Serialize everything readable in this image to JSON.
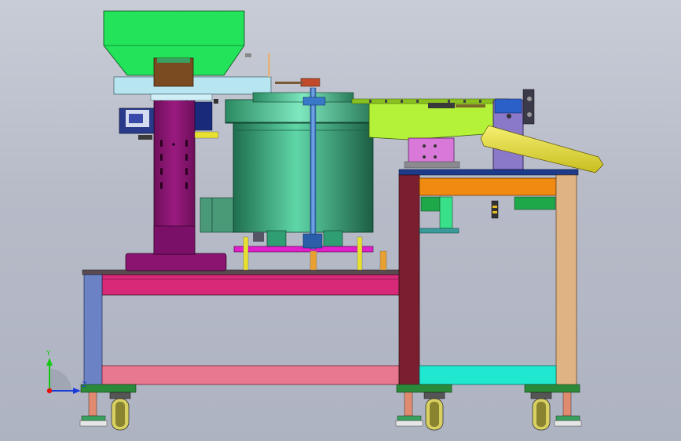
{
  "window": {
    "background_top": "#c8ccd6",
    "background_bottom": "#aeb3c2"
  },
  "triad": {
    "y_label": "Y",
    "z_label": "Z",
    "y_color": "#14c814",
    "z_color": "#1a3cd8",
    "origin_color": "#e01010"
  },
  "colors": {
    "hopper": "#22e35a",
    "column": "#8a1470",
    "column_cap": "#7a4a20",
    "bowl": "#2f9e72",
    "rod": "#3a78c8",
    "track": "#b4f23a",
    "table_top_left": "#d82878",
    "table_frame": "#5a78c0",
    "right_post": "#7a1e30",
    "right_beam": "#f08a10",
    "right_leg": "#e0b482",
    "lower_rail_left": "#e87890",
    "lower_rail_right": "#20e8d0",
    "base_plate": "#e020c8",
    "slide_block": "#d878d8",
    "chute": "#e8e030",
    "vertical_plate": "#8a78c8",
    "caster": "#d8d060"
  },
  "icons": [
    "caster-wheel-icon",
    "leveling-foot-icon",
    "axis-triad-icon"
  ]
}
